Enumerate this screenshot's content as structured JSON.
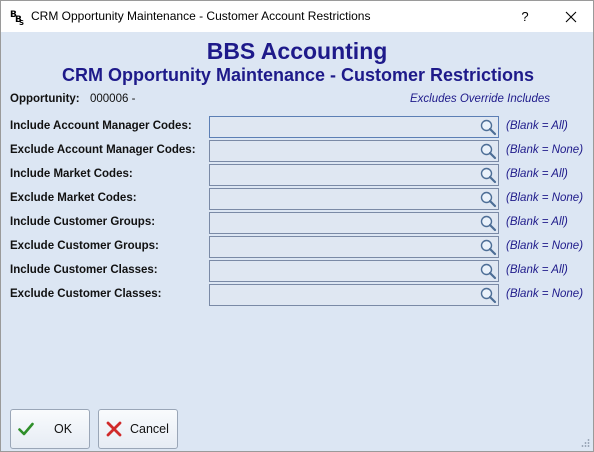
{
  "window": {
    "title": "CRM Opportunity Maintenance - Customer Account Restrictions",
    "help_label": "?"
  },
  "header": {
    "company": "BBS Accounting",
    "subtitle": "CRM Opportunity Maintenance - Customer Restrictions"
  },
  "opportunity": {
    "label": "Opportunity:",
    "value": "000006 -",
    "note": "Excludes Override Includes"
  },
  "rows": [
    {
      "label": "Include Account Manager Codes:",
      "value": "",
      "hint": "(Blank = All)"
    },
    {
      "label": "Exclude Account Manager Codes:",
      "value": "",
      "hint": "(Blank = None)"
    },
    {
      "label": "Include Market Codes:",
      "value": "",
      "hint": "(Blank = All)"
    },
    {
      "label": "Exclude Market Codes:",
      "value": "",
      "hint": "(Blank = None)"
    },
    {
      "label": "Include Customer Groups:",
      "value": "",
      "hint": "(Blank = All)"
    },
    {
      "label": "Exclude Customer Groups:",
      "value": "",
      "hint": "(Blank = None)"
    },
    {
      "label": "Include Customer Classes:",
      "value": "",
      "hint": "(Blank = All)"
    },
    {
      "label": "Exclude Customer Classes:",
      "value": "",
      "hint": "(Blank = None)"
    }
  ],
  "buttons": {
    "ok": "OK",
    "cancel": "Cancel"
  },
  "icons": {
    "app": "app-icon",
    "search": "search-icon",
    "ok": "check-icon",
    "cancel": "x-icon"
  },
  "colors": {
    "accent_text": "#1e1a8a",
    "form_background": "#dce6f3"
  }
}
